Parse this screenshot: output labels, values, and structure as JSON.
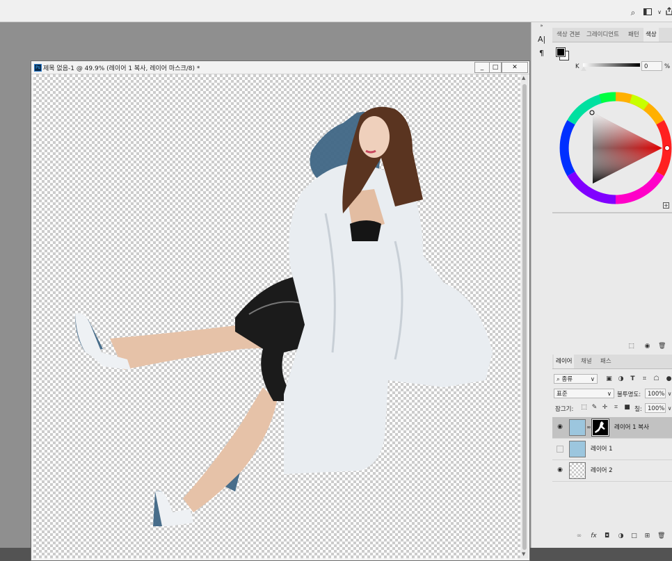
{
  "document": {
    "title": "제목 없음-1 @ 49.9% (레이어 1 복사, 레이어 마스크/8) *",
    "window_buttons": [
      "_",
      "□",
      "✕"
    ]
  },
  "top_icons": [
    "search-icon",
    "workspace-icon",
    "chevron-down-icon",
    "share-icon"
  ],
  "character_panel_glyphs": [
    "A|",
    "¶"
  ],
  "color_panel": {
    "tabs": [
      "색상 견본",
      "그레이디언트",
      "패턴",
      "색상"
    ],
    "active_tab": "색상",
    "slider_label": "K",
    "slider_value": "0",
    "unit": "%",
    "foreground_color": "#000000",
    "background_color": "#ffffff"
  },
  "layers_panel": {
    "tabs": [
      "레이어",
      "채널",
      "패스"
    ],
    "active_tab": "레이어",
    "filter_label": "종류",
    "blend_mode": "표준",
    "opacity_label": "불투명도:",
    "opacity_value": "100%",
    "lock_label": "잠그기:",
    "fill_label": "칠:",
    "fill_value": "100%",
    "layers": [
      {
        "name": "레이어 1 복사",
        "visible": true,
        "selected": true,
        "has_mask": true
      },
      {
        "name": "레이어 1",
        "visible": false,
        "selected": false,
        "has_mask": false
      },
      {
        "name": "레이어 2",
        "visible": true,
        "selected": false,
        "has_mask": false
      }
    ]
  },
  "colors": {
    "accent_blue": "#31a8ff",
    "selection_gray": "#c2c2c2"
  }
}
